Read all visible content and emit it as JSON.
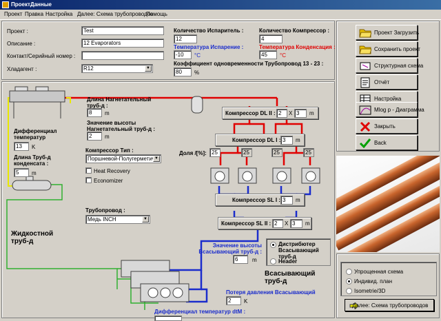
{
  "window": {
    "title": "ПроектДанные"
  },
  "menu": [
    "Проект",
    "Правка",
    "Настройка",
    "Далее: Схема трубопроводов",
    "Помощь"
  ],
  "form": {
    "project_label": "Проект :",
    "project_value": "Test",
    "description_label": "Описание :",
    "description_value": "12 Evaporators",
    "contact_label": "Контакт/Серийный номер :",
    "contact_value": "",
    "refrigerant_label": "Хладагент :",
    "refrigerant_value": "R12"
  },
  "params": {
    "evap_count_label": "Количество Испаритель :",
    "evap_count_value": "12",
    "comp_count_label": "Количество Компрессор :",
    "comp_count_value": "4",
    "evap_temp_label": "Температура Испарение :",
    "evap_temp_value": "-10",
    "evap_temp_unit": "°C",
    "cond_temp_label": "Температура Конденсация :",
    "cond_temp_value": "45",
    "cond_temp_unit": "°C",
    "simultaneity_label": "Коэффициент одновременности Трубопровод  13 - 23 :",
    "simultaneity_value": "80",
    "simultaneity_unit": "%"
  },
  "diagram": {
    "discharge_len_label": "Длина Нагнетательный труб-д :",
    "discharge_len_value": "8",
    "discharge_height_label": "Значение высоты Нагнетательный труб-д :",
    "discharge_height_value": "2",
    "unit_m": "m",
    "unit_k": "K",
    "diff_temp_label": "Дифференциал температур",
    "diff_temp_value": "13",
    "condensate_len_label": "Длина Труб-д конденсата :",
    "condensate_len_value": "5",
    "comp_type_label": "Компрессор Тип :",
    "comp_type_value": "Поршневой-Полугерметич",
    "heat_recovery": "Heat Recovery",
    "economizer": "Economizer",
    "pipeline_label": "Трубопровод :",
    "pipeline_value": "Медь INCH",
    "liquid_label": "Жидкостной труб-д",
    "suction_label": "Всасывающий труб-д",
    "dl2_label": "Компрессор DL II :",
    "dl2_a": "2",
    "dl2_x": "X",
    "dl2_b": "3",
    "dl1_label": "Компрессор DL I :",
    "dl1_value": "3",
    "share_label": "Доля /[%]:",
    "shares": [
      "25",
      "25",
      "25",
      "25"
    ],
    "sl1_label": "Компрессор SL I :",
    "sl1_value": "3",
    "sl2_label": "Компрессор SL II :",
    "sl2_a": "2",
    "sl2_x": "X",
    "sl2_b": "3",
    "suction_height_label": "Значение высоты Всасывающий труб-д :",
    "suction_height_value": "6",
    "distributor_label": "Дистрибютер Всасывающий труб-д",
    "header_label": "Header",
    "pressure_drop_label": "Потеря давления Всасывающий",
    "pressure_drop_value": "2",
    "diff_temp_dtm_label": "Дифференциал температур dtM :"
  },
  "buttons": {
    "load": "Проект Загрузить",
    "save": "Сохранить проект",
    "structure": "Структурная схема",
    "report": "Отчёт",
    "settings": "Настройка",
    "diagram": "Mlog p - Диаграмма",
    "close": "Закрыть",
    "back": "Back"
  },
  "view_options": {
    "simple": "Упрощенная схема",
    "individual": "Индивид. план",
    "iso": "Isometrie/3D",
    "next_button": "Далее: Схема трубопроводов"
  }
}
